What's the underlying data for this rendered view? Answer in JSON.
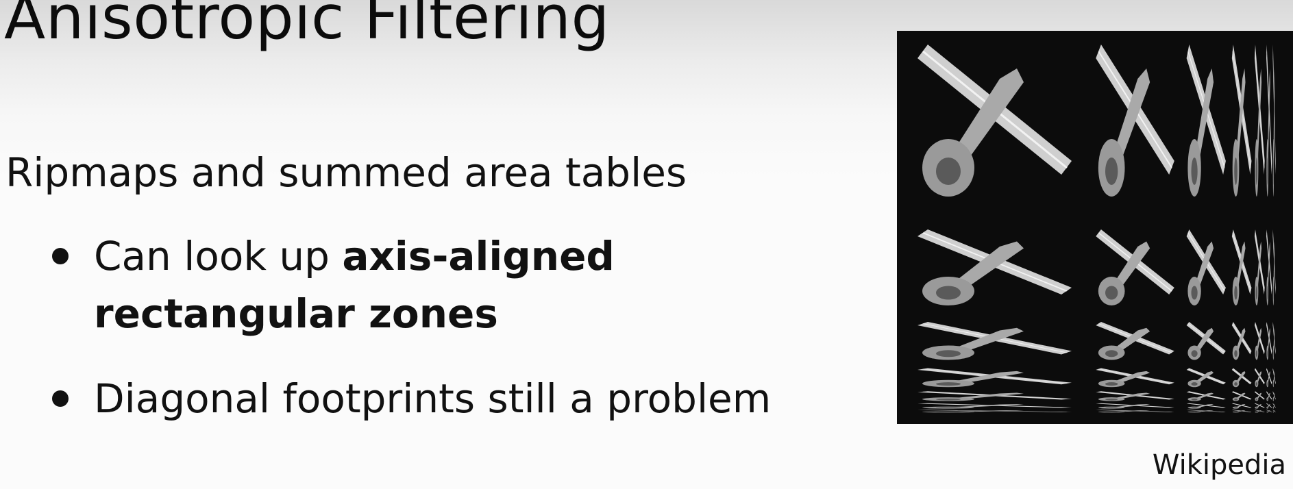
{
  "slide": {
    "title": "Anisotropic Filtering",
    "subtitle": "Ripmaps and summed area tables",
    "bullets": [
      {
        "text_before": "Can look up ",
        "bold_text": "axis-aligned rectangular zones",
        "text_after": ""
      },
      {
        "text_before": "Diagonal footprints still a problem",
        "bold_text": "",
        "text_after": ""
      }
    ],
    "image_source": "Wikipedia"
  }
}
